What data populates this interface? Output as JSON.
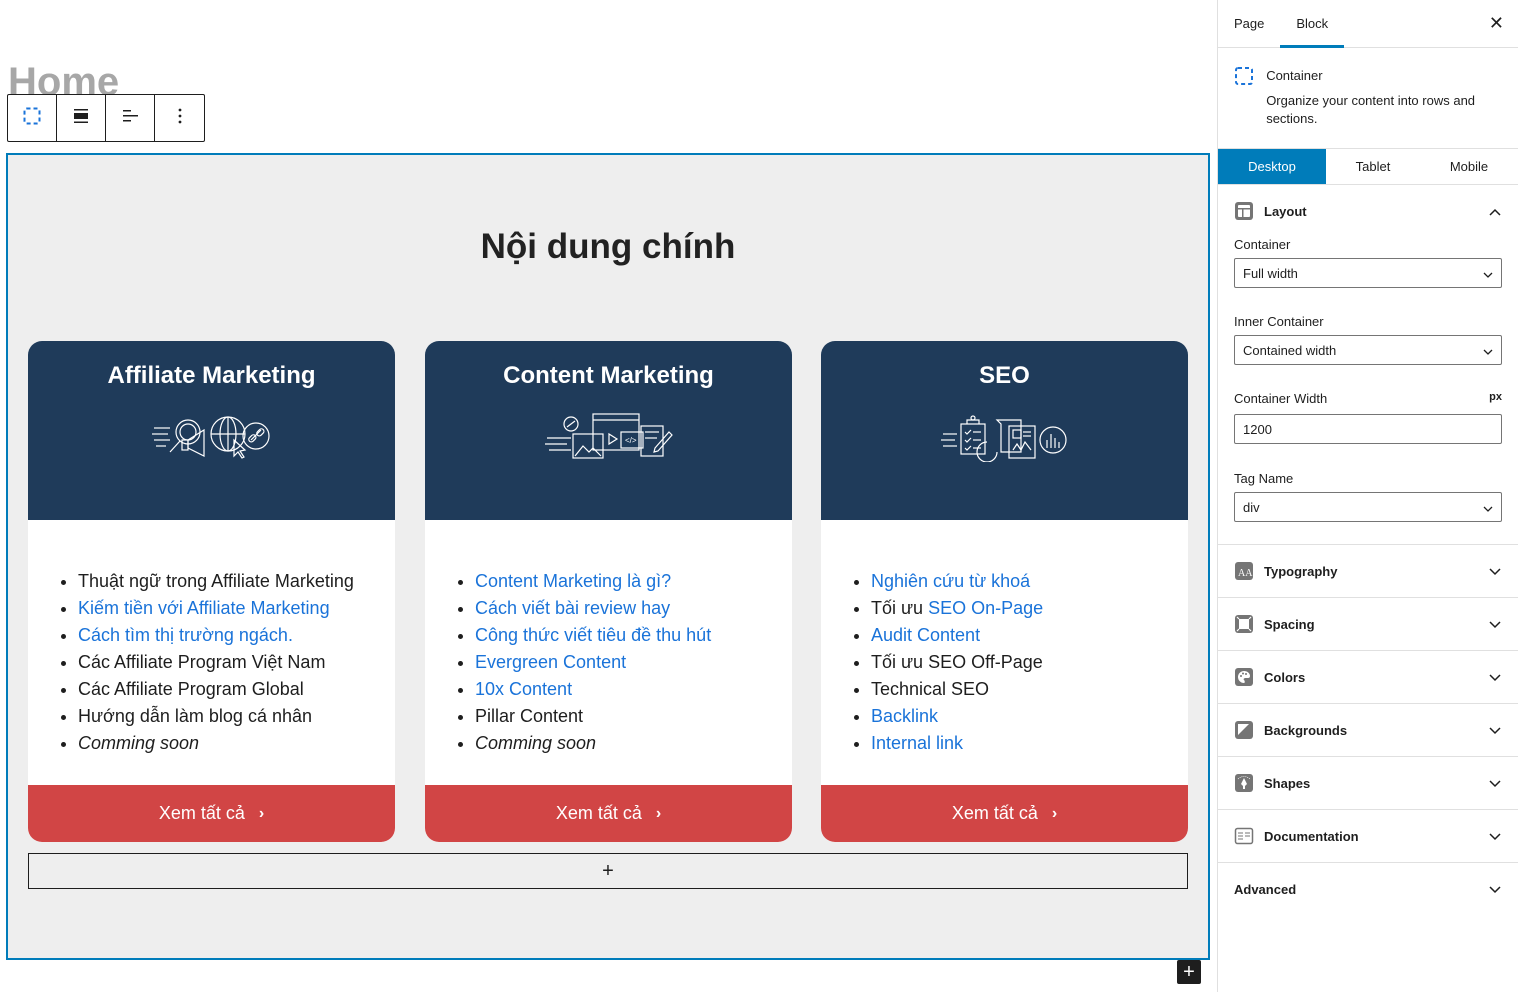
{
  "page": {
    "title": "Home"
  },
  "toolbar": {
    "buttons": [
      {
        "name": "container-block-type-button",
        "icon": "dashed-square-icon"
      },
      {
        "name": "block-width-button",
        "icon": "align-full-icon"
      },
      {
        "name": "content-align-button",
        "icon": "align-left-icon"
      },
      {
        "name": "more-options-button",
        "icon": "vertical-ellipsis-icon"
      }
    ]
  },
  "section": {
    "heading": "Nội dung chính",
    "cards": [
      {
        "title": "Affiliate Marketing",
        "illustration": "affiliate-marketing-illustration",
        "items": [
          {
            "text": "Thuật ngữ trong Affiliate Marketing",
            "link": false
          },
          {
            "text": "Kiếm tiền với Affiliate Marketing",
            "link": true
          },
          {
            "text": "Cách tìm thị trường ngách.",
            "link": true
          },
          {
            "text": "Các Affiliate Program Việt Nam",
            "link": false
          },
          {
            "text": "Các Affiliate Program Global",
            "link": false
          },
          {
            "text": "Hướng dẫn làm blog cá nhân",
            "link": false
          },
          {
            "text": "Comming soon",
            "link": false,
            "italic": true
          }
        ],
        "button": "Xem tất cả"
      },
      {
        "title": "Content Marketing",
        "illustration": "content-marketing-illustration",
        "items": [
          {
            "text": "Content Marketing là gì?",
            "link": true
          },
          {
            "text": "Cách viết bài review hay",
            "link": true
          },
          {
            "text": "Công thức viết tiêu đề thu hút",
            "link": true
          },
          {
            "text": "Evergreen Content",
            "link": true
          },
          {
            "text": "10x Content",
            "link": true
          },
          {
            "text": "Pillar Content",
            "link": false
          },
          {
            "text": "Comming soon",
            "link": false,
            "italic": true
          }
        ],
        "button": "Xem tất cả"
      },
      {
        "title": "SEO",
        "illustration": "seo-illustration",
        "items": [
          {
            "text": "Nghiên cứu từ khoá",
            "link": true
          },
          {
            "prefix": "Tối ưu ",
            "text": "SEO On-Page",
            "link": true
          },
          {
            "text": "Audit Content",
            "link": true
          },
          {
            "text": "Tối ưu SEO Off-Page",
            "link": false
          },
          {
            "text": "Technical SEO",
            "link": false
          },
          {
            "text": "Backlink",
            "link": true
          },
          {
            "text": "Internal link",
            "link": true
          }
        ],
        "button": "Xem tất cả"
      }
    ],
    "appender_label": "+",
    "inserter_label": "+"
  },
  "sidebar": {
    "tabs": [
      {
        "label": "Page",
        "active": false
      },
      {
        "label": "Block",
        "active": true
      }
    ],
    "close_label": "✕",
    "block": {
      "title": "Container",
      "description": "Organize your content into rows and sections."
    },
    "devices": [
      {
        "label": "Desktop",
        "active": true
      },
      {
        "label": "Tablet",
        "active": false
      },
      {
        "label": "Mobile",
        "active": false
      }
    ],
    "layout": {
      "label": "Layout",
      "container_label": "Container",
      "container_value": "Full width",
      "inner_container_label": "Inner Container",
      "inner_container_value": "Contained width",
      "container_width_label": "Container Width",
      "container_width_unit": "px",
      "container_width_value": "1200",
      "tag_name_label": "Tag Name",
      "tag_name_value": "div"
    },
    "panels": [
      {
        "label": "Typography",
        "icon": "typography-icon"
      },
      {
        "label": "Spacing",
        "icon": "spacing-icon"
      },
      {
        "label": "Colors",
        "icon": "palette-icon"
      },
      {
        "label": "Backgrounds",
        "icon": "background-icon"
      },
      {
        "label": "Shapes",
        "icon": "shapes-icon"
      },
      {
        "label": "Documentation",
        "icon": "documentation-icon"
      },
      {
        "label": "Advanced",
        "icon": ""
      }
    ]
  },
  "colors": {
    "accent": "#007cba",
    "card_header": "#1f3b5a",
    "card_button": "#d14545",
    "link": "#1a73d9",
    "canvas_bg": "#eeeeee"
  }
}
